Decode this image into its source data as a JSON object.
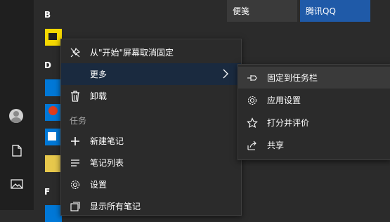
{
  "start_list": {
    "letters": [
      "B",
      "D",
      "F"
    ]
  },
  "tiles": {
    "left_label": "便笺",
    "right_label": "腾讯QQ",
    "right_color": "#1f5aa8"
  },
  "context_menu": {
    "unpin": "从\"开始\"屏幕取消固定",
    "more": "更多",
    "uninstall": "卸载",
    "section_tasks": "任务",
    "new_note": "新建笔记",
    "note_list": "笔记列表",
    "settings": "设置",
    "show_all": "显示所有笔记"
  },
  "submenu": {
    "pin_taskbar": "固定到任务栏",
    "app_settings": "应用设置",
    "rate_review": "打分并评价",
    "share": "共享"
  },
  "colors": {
    "accent_blue": "#1f5aa8",
    "hover_blue": "#1a2a3f"
  }
}
